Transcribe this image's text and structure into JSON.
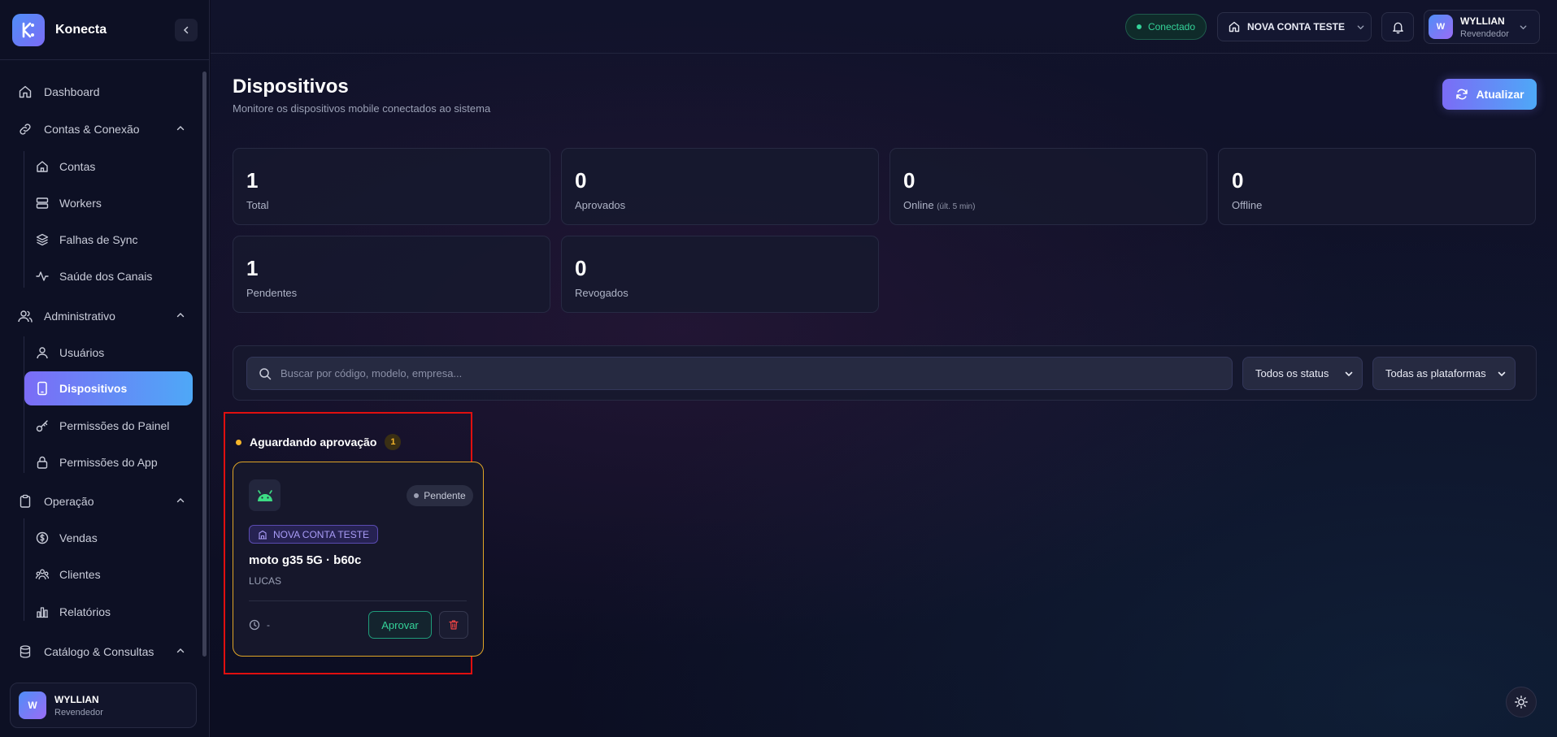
{
  "brand": {
    "name": "Konecta",
    "logo_letter": "K",
    "colors": {
      "accent_start": "#7b6cf6",
      "accent_end": "#4ea8f7"
    }
  },
  "sidebar": {
    "items": [
      {
        "label": "Dashboard",
        "icon": "home-icon"
      },
      {
        "label": "Contas & Conexão",
        "icon": "link-icon",
        "group": true
      },
      {
        "label": "Contas",
        "icon": "house-icon"
      },
      {
        "label": "Workers",
        "icon": "server-icon"
      },
      {
        "label": "Falhas de Sync",
        "icon": "layers-icon"
      },
      {
        "label": "Saúde dos Canais",
        "icon": "activity-icon"
      },
      {
        "label": "Administrativo",
        "icon": "users-icon",
        "group": true
      },
      {
        "label": "Usuários",
        "icon": "user-icon"
      },
      {
        "label": "Dispositivos",
        "icon": "smartphone-icon",
        "active": true
      },
      {
        "label": "Permissões do Painel",
        "icon": "key-icon"
      },
      {
        "label": "Permissões do App",
        "icon": "lock-icon"
      },
      {
        "label": "Operação",
        "icon": "clipboard-icon",
        "group": true
      },
      {
        "label": "Vendas",
        "icon": "dollar-icon"
      },
      {
        "label": "Clientes",
        "icon": "people-icon"
      },
      {
        "label": "Relatórios",
        "icon": "bar-chart-icon"
      },
      {
        "label": "Catálogo & Consultas",
        "icon": "database-icon",
        "group": true
      }
    ],
    "user": {
      "initial": "W",
      "name": "WYLLIAN",
      "role": "Revendedor"
    }
  },
  "topbar": {
    "connection_status": "Conectado",
    "account": "NOVA CONTA TESTE",
    "user": {
      "initial": "W",
      "name": "WYLLIAN",
      "role": "Revendedor"
    }
  },
  "page": {
    "title": "Dispositivos",
    "subtitle": "Monitore os dispositivos mobile conectados ao sistema",
    "refresh_label": "Atualizar"
  },
  "stats": [
    {
      "value": "1",
      "label": "Total"
    },
    {
      "value": "0",
      "label": "Aprovados"
    },
    {
      "value": "0",
      "label": "Online",
      "note": "(últ. 5 min)"
    },
    {
      "value": "0",
      "label": "Offline"
    },
    {
      "value": "1",
      "label": "Pendentes"
    },
    {
      "value": "0",
      "label": "Revogados"
    }
  ],
  "filters": {
    "search_placeholder": "Buscar por código, modelo, empresa...",
    "status_select": "Todos os status",
    "platform_select": "Todas as plataformas"
  },
  "pending": {
    "title": "Aguardando aprovação",
    "count": "1",
    "device": {
      "status": "Pendente",
      "company": "NOVA CONTA TESTE",
      "name": "moto g35 5G · b60c",
      "user": "LUCAS",
      "last_seen": "-",
      "approve_label": "Aprovar",
      "platform_icon": "android-icon"
    }
  }
}
